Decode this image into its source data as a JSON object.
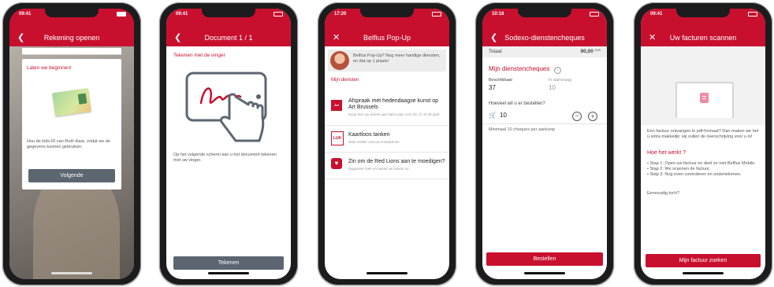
{
  "phones": {
    "p1": {
      "time": "09:41",
      "title": "Rekening openen",
      "card_heading": "Laten we beginnen!",
      "card_text": "Hou de kids-ID van Ruth klaar, zodat we de gegevens kunnen gebruiken.",
      "button": "Volgende"
    },
    "p2": {
      "time": "09:41",
      "title": "Document 1 / 1",
      "instruction": "Tekenen met de vinger",
      "note": "Op het volgende scherm kan u het document tekenen met uw vinger.",
      "button": "Tekenen"
    },
    "p3": {
      "time": "17:20",
      "title": "Belfius Pop-Up",
      "banner": "Belfius Pop-Up? Nog meer handige diensten, en dat op 1 plaats!",
      "section": "Mijn diensten",
      "items": [
        {
          "title": "Afspraak met hedendaagse kunst op Art Brussels",
          "desc": "Koop hier uw tickets aan halve prijs voor 26, 27 et 28 april",
          "logo": "Art"
        },
        {
          "title": "Kaartloos tanken",
          "desc": "Tank sneller met uw smartphone",
          "logo": "LUK"
        },
        {
          "title": "Zin om de Red Lions aan te moedigen?",
          "desc": "Supporter mee en bestel uw tickets nu.",
          "logo": "heart"
        }
      ]
    },
    "p4": {
      "time": "10:18",
      "title": "Sodexo-dienstencheques",
      "total_label": "Totaal:",
      "total_value": "90,00",
      "total_unit": "EUR",
      "section": "Mijn dienstencheques",
      "available_label": "Beschikbaar",
      "available_value": "37",
      "pending_label": "In aanvraag",
      "pending_value": "10",
      "question": "Hoeveel wil u er bestellen?",
      "quantity": "10",
      "min_note": "Minimaal 10 cheques per aankoop",
      "button": "Bestellen"
    },
    "p5": {
      "time": "09:41",
      "title": "Uw facturen scannen",
      "intro": "Een factuur ontvangen in pdf-formaat? Dan maken we het u extra makkelijk: wij vullen de overschrijving voor u in!",
      "how_title": "Hoe het werkt ?",
      "steps": [
        "Stap 1: Open uw factuur en deel ze met Belfius Mobile.",
        "Stap 2: We scannen de factuur.",
        "Stap 3: Nog even controleren en ondertekenen."
      ],
      "outro": "Eenvoudig toch?",
      "button": "Mijn factuur zoeken"
    }
  }
}
